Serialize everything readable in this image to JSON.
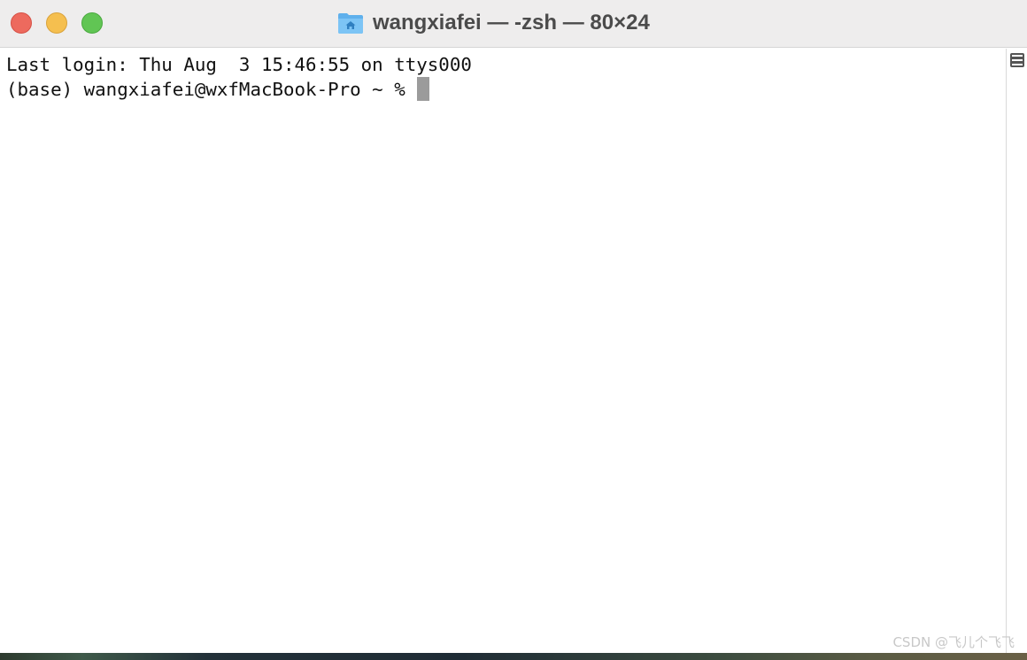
{
  "window": {
    "title": "wangxiafei — -zsh — 80×24",
    "title_icon": "home-folder-icon",
    "controls": [
      "close",
      "minimize",
      "zoom"
    ]
  },
  "terminal": {
    "lines": [
      "Last login: Thu Aug  3 15:46:55 on ttys000",
      "(base) wangxiafei@wxfMacBook-Pro ~ % "
    ]
  },
  "scrollbar": {
    "icon": "split-pane-icon"
  },
  "watermark": "CSDN @飞儿个飞飞",
  "colors": {
    "close": "#ed6a5e",
    "minimize": "#f5bf4f",
    "zoom": "#61c554",
    "cursor": "#9b9b9b",
    "titlebar": "#eeeded",
    "folder": "#5fb0ec"
  }
}
